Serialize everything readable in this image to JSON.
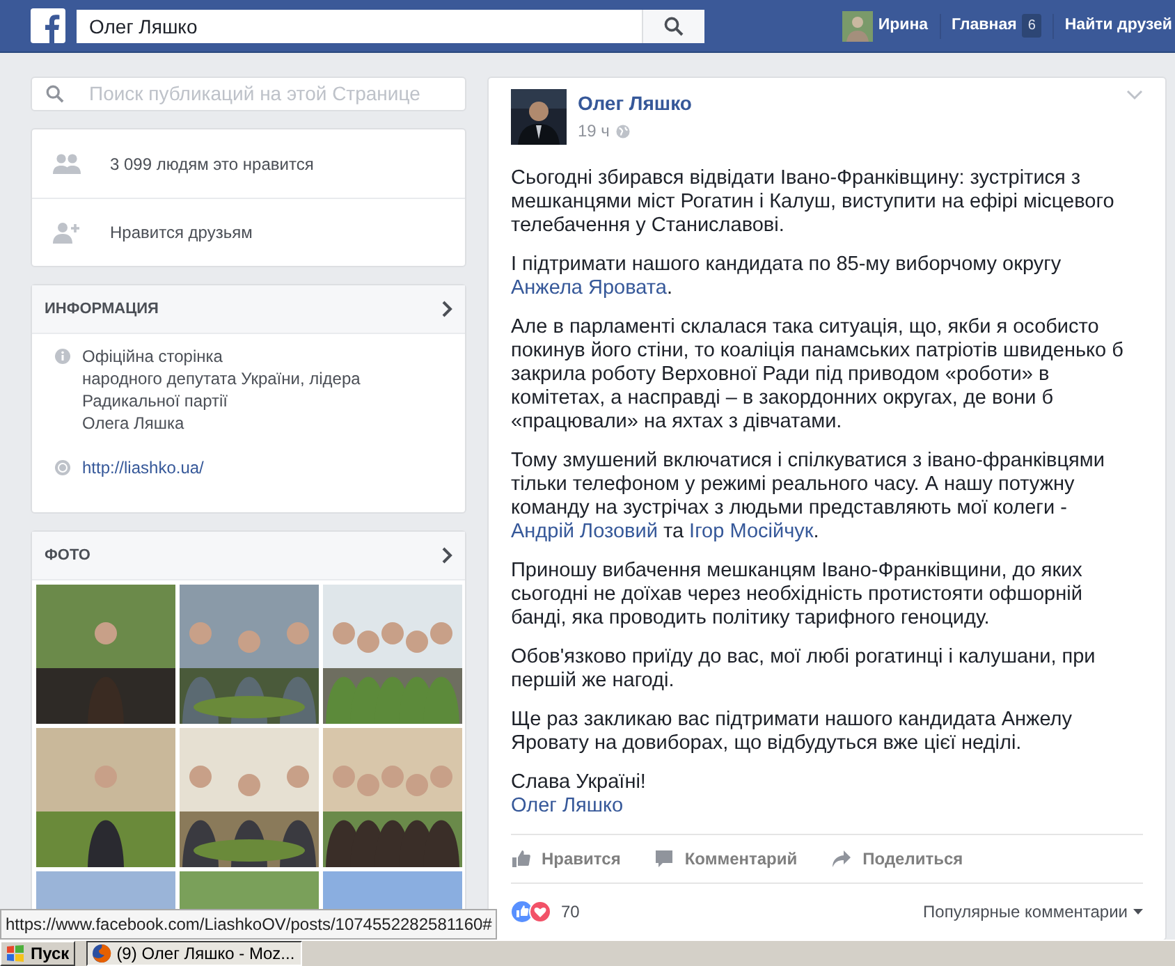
{
  "topbar": {
    "search_value": "Олег Ляшко",
    "user": "Ирина",
    "home": "Главная",
    "home_count": "6",
    "find_friends": "Найти друзей"
  },
  "sidebar": {
    "search_placeholder": "Поиск публикаций на этой Странице",
    "stats": [
      {
        "kind": "likes",
        "text": "3 099 людям это нравится"
      },
      {
        "kind": "friends",
        "text": "Нравится друзьям"
      }
    ],
    "info": {
      "title": "ИНФОРМАЦИЯ",
      "items": [
        {
          "kind": "about",
          "text": "Офіційна сторінка\nнародного депутата України, лідера\nРадикальної партії\nОлега Ляшка"
        },
        {
          "kind": "website",
          "text": "http://liashko.ua/"
        }
      ]
    },
    "photos": {
      "title": "ФОТО"
    }
  },
  "post": {
    "author": "Олег Ляшко",
    "time": "19 ч",
    "paragraphs": [
      [
        {
          "text": "Сьогодні збирався відвідати Івано-Франківщину: зустрітися з мешканцями міст Рогатин і Калуш, виступити на ефірі місцевого телебачення у Станиславові."
        }
      ],
      [
        {
          "text": "І підтримати нашого кандидата по 85-му виборчому округу "
        },
        {
          "text": "Анжела Яровата",
          "link": true
        },
        {
          "text": "."
        }
      ],
      [
        {
          "text": "Але в парламенті склалася така ситуація, що, якби я особисто покинув його стіни, то коаліція панамських патріотів швиденько б закрила роботу Верховної Ради під приводом «роботи» в комітетах, а насправді – в закордонних округах, де вони б «працювали» на яхтах з дівчатами."
        }
      ],
      [
        {
          "text": "Тому змушений включатися і спілкуватися з івано-франківцями тільки телефоном у режимі реального часу. А нашу потужну команду на зустрічах з людьми представляють мої колеги - "
        },
        {
          "text": "Андрій Лозовий",
          "link": true
        },
        {
          "text": " та "
        },
        {
          "text": "Ігор Мосійчук",
          "link": true
        },
        {
          "text": "."
        }
      ],
      [
        {
          "text": "Приношу вибачення мешканцям Івано-Франківщини, до яких сьогодні не доїхав через необхідність протистояти офшорній банді, яка проводить політику тарифного геноциду."
        }
      ],
      [
        {
          "text": "Обов'язково приїду до вас, мої любі рогатинці і калушани, при першій же нагоді."
        }
      ],
      [
        {
          "text": "Ще раз закликаю вас підтримати нашого кандидата Анжелу Яровату на довиборах, що відбудуться вже цієї неділі."
        }
      ],
      [
        {
          "text": "Слава Україні!\n"
        },
        {
          "text": "Олег Ляшко",
          "link": true
        }
      ]
    ],
    "actions": [
      {
        "kind": "like",
        "label": "Нравится"
      },
      {
        "kind": "comment",
        "label": "Комментарий"
      },
      {
        "kind": "share",
        "label": "Поделиться"
      }
    ],
    "reactions_count": "70",
    "comments_order": "Популярные комментарии"
  },
  "status_bar": {
    "url": "https://www.facebook.com/LiashkoOV/posts/1074552282581160#"
  },
  "taskbar": {
    "start": "Пуск",
    "windows": [
      {
        "title": "(9) Олег Ляшко - Moz..."
      }
    ]
  }
}
